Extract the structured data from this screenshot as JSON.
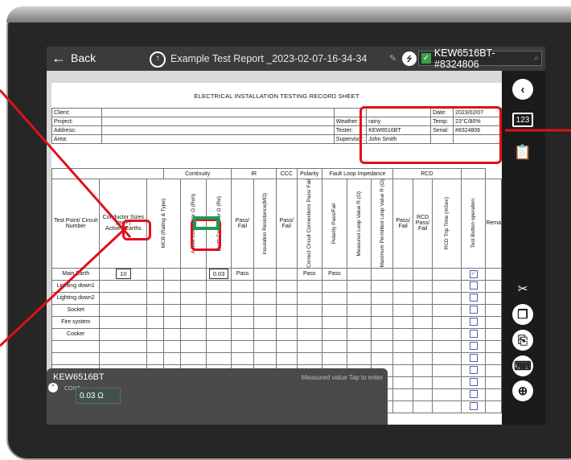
{
  "app": {
    "back_label": "Back",
    "report_title": "Example Test Report _2023-02-07-16-34-34",
    "device_label": "KEW6516BT-#8324806"
  },
  "sheet": {
    "title": "ELECTRICAL INSTALLATION TESTING RECORD SHEET",
    "info_rows": [
      {
        "label": "Client:",
        "mid_label": "",
        "mid_value": "",
        "right_label": "Date:",
        "right_value": "2023/02/07"
      },
      {
        "label": "Project:",
        "mid_label": "Weather:",
        "mid_value": "rainy",
        "right_label": "Temp:",
        "right_value": "23°C/80%"
      },
      {
        "label": "Address:",
        "mid_label": "Tester:",
        "mid_value": "KEW6516BT",
        "right_label": "Serial:",
        "right_value": "#8324806"
      },
      {
        "label": "Area:",
        "mid_label": "Supervisor:",
        "mid_value": "John Smith",
        "right_label": "",
        "right_value": ""
      }
    ],
    "group_headers": {
      "continuity": "Continuity",
      "ir": "IR",
      "ccc": "CCC",
      "polarity": "Polarity",
      "fault_loop": "Fault Loop Impedance",
      "rcd": "RCD"
    },
    "columns": {
      "test_point": "Test Point/ Circuit Number",
      "conductor_sizes": "Conductor Sizes (mm²) Actives/Earths",
      "mcb": "MCB (Rating & Type)",
      "active_conductor": "Active Conductor Ω (Roh)",
      "earth_conductor": "Earth Conductor Ω (Re)",
      "cont_pass_fail": "Pass/ Fail",
      "insulation": "Insulation Resistance(MΩ)",
      "ir_pass_fail": "Pass/ Fail",
      "correct_circuit": "Correct Circuit Connections Pass/ Fail",
      "polarity_pf": "Polarity Pass/Fail",
      "measured_loop": "Measured Loop Value R (Ω)",
      "max_loop": "Maximum Permitted Loop Value R (Ω)",
      "loop_pass_fail": "Pass/ Fail",
      "rcd_pass_fail": "RCD Pass/ Fail",
      "rcd_trip": "RCD Trip Time (mSec)",
      "test_button": "Test Button operation",
      "remarks": "Rema"
    },
    "rows": [
      {
        "name": "Main Earth",
        "conductor": "10",
        "earth": "0.03",
        "cont_pf": "Pass",
        "ccc": "Pass",
        "polarity": "Pass",
        "checked": true
      },
      {
        "name": "Lighting down1",
        "conductor": "",
        "earth": "",
        "cont_pf": "",
        "ccc": "",
        "polarity": "",
        "checked": false
      },
      {
        "name": "Lighting down2",
        "conductor": "",
        "earth": "",
        "cont_pf": "",
        "ccc": "",
        "polarity": "",
        "checked": false
      },
      {
        "name": "Socket",
        "conductor": "",
        "earth": "",
        "cont_pf": "",
        "ccc": "",
        "polarity": "",
        "checked": false
      },
      {
        "name": "Fire system",
        "conductor": "",
        "earth": "",
        "cont_pf": "",
        "ccc": "",
        "polarity": "",
        "checked": false
      },
      {
        "name": "Cooker",
        "conductor": "",
        "earth": "",
        "cont_pf": "",
        "ccc": "",
        "polarity": "",
        "checked": false
      },
      {
        "name": "",
        "conductor": "",
        "earth": "",
        "cont_pf": "",
        "ccc": "",
        "polarity": "",
        "checked": false
      },
      {
        "name": "",
        "conductor": "",
        "earth": "",
        "cont_pf": "",
        "ccc": "",
        "polarity": "",
        "checked": false
      },
      {
        "name": "",
        "conductor": "",
        "earth": "",
        "cont_pf": "",
        "ccc": "",
        "polarity": "",
        "checked": false
      },
      {
        "name": "",
        "conductor": "",
        "earth": "",
        "cont_pf": "",
        "ccc": "",
        "polarity": "",
        "checked": false
      },
      {
        "name": "",
        "conductor": "",
        "earth": "",
        "cont_pf": "",
        "ccc": "",
        "polarity": "",
        "checked": false
      },
      {
        "name": "",
        "conductor": "",
        "earth": "",
        "cont_pf": "",
        "ccc": "",
        "polarity": "",
        "checked": false
      }
    ]
  },
  "meter_panel": {
    "device_name": "KEW6516BT",
    "hint": "Measured value Tap to enter",
    "mode": "CONT",
    "value": "0.03",
    "unit": "Ω"
  },
  "sidebar_icons": [
    "chevron-left-icon",
    "numeric-keypad-icon",
    "clipboard-list-icon",
    "cut-icon",
    "copy-icon",
    "paste-icon",
    "keyboard-icon",
    "zoom-icon"
  ],
  "colors": {
    "highlight_red": "#e0101a",
    "highlight_green": "#1b9a53",
    "connected_green": "#3aa04a"
  }
}
